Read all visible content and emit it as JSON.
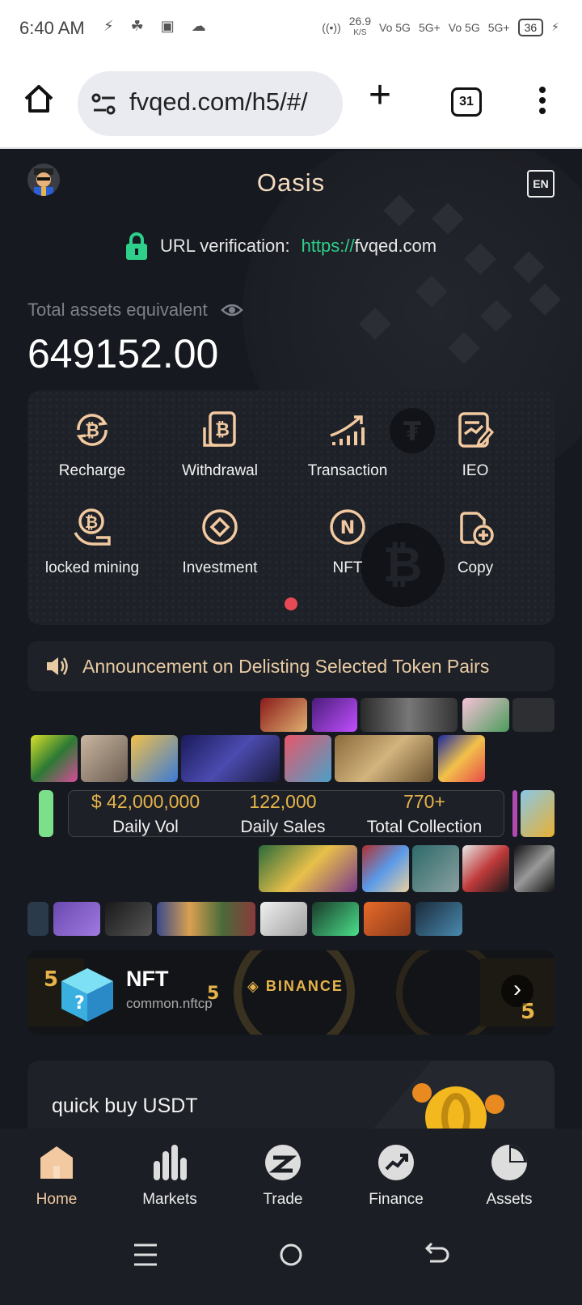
{
  "status_bar": {
    "time": "6:40 AM",
    "speed": "26.9",
    "speed_unit": "K/S",
    "net1": "Vo 5G",
    "net2": "5G+",
    "net3": "Vo 5G",
    "net4": "5G+",
    "battery": "36"
  },
  "browser": {
    "url": "fvqed.com/h5/#/",
    "tab_count": "31"
  },
  "header": {
    "title": "Oasis",
    "lang": "EN"
  },
  "verification": {
    "label": "URL verification:",
    "scheme": "https://",
    "domain": "fvqed.com"
  },
  "assets": {
    "label": "Total assets equivalent",
    "value": "649152.00"
  },
  "menu": [
    {
      "label": "Recharge",
      "icon": "bitcoin-refresh-icon"
    },
    {
      "label": "Withdrawal",
      "icon": "bitcoin-wallet-icon"
    },
    {
      "label": "Transaction",
      "icon": "chart-growth-icon"
    },
    {
      "label": "IEO",
      "icon": "document-edit-icon"
    },
    {
      "label": "locked mining",
      "icon": "bitcoin-hand-icon"
    },
    {
      "label": "Investment",
      "icon": "target-icon"
    },
    {
      "label": "NFT",
      "icon": "nft-coin-icon"
    },
    {
      "label": "Copy",
      "icon": "copy-add-icon"
    }
  ],
  "announcement": {
    "text": "Announcement on Delisting Selected Token Pairs"
  },
  "stats": {
    "daily_vol_value": "$ 42,000,000",
    "daily_vol_label": "Daily Vol",
    "daily_sales_value": "122,000",
    "daily_sales_label": "Daily Sales",
    "collection_value": "770+",
    "collection_label": "Total Collection"
  },
  "banner": {
    "title": "NFT",
    "subtitle": "common.nftcp",
    "brand": "◈ BINANCE"
  },
  "quickbuy": {
    "text": "quick buy USDT"
  },
  "tabbar": [
    {
      "label": "Home",
      "icon": "home-icon"
    },
    {
      "label": "Markets",
      "icon": "bar-chart-icon"
    },
    {
      "label": "Trade",
      "icon": "trade-icon"
    },
    {
      "label": "Finance",
      "icon": "finance-trend-icon"
    },
    {
      "label": "Assets",
      "icon": "pie-chart-icon"
    }
  ],
  "colors": {
    "accent": "#e7b44a",
    "title": "#f4dcc0",
    "green": "#2ecf8a",
    "indicator": "#e84a55"
  }
}
